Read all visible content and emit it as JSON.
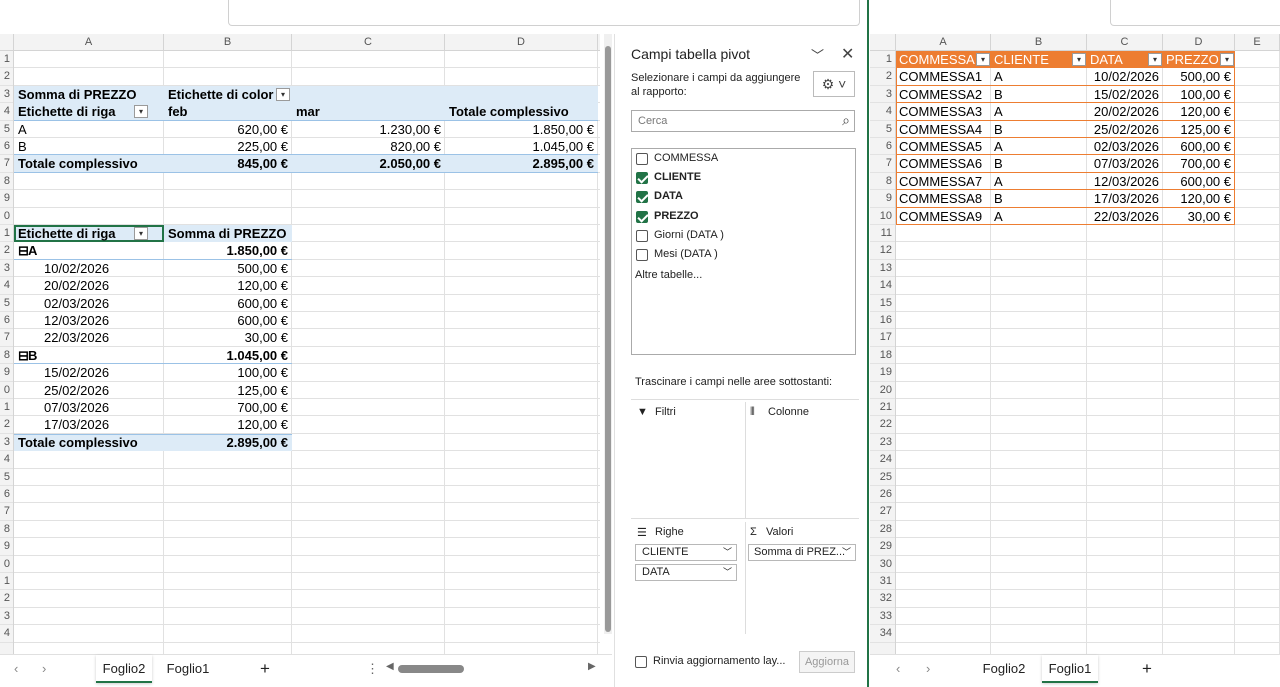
{
  "left": {
    "columns": [
      "A",
      "B",
      "C",
      "D"
    ],
    "rows": [
      "1",
      "2",
      "3",
      "4",
      "5",
      "6",
      "7",
      "8",
      "9",
      "0",
      "1",
      "2",
      "3",
      "4",
      "5",
      "6",
      "7",
      "8",
      "9",
      "0",
      "1",
      "2",
      "3",
      "4",
      "5",
      "6",
      "7",
      "8",
      "9",
      "0",
      "1",
      "2",
      "3",
      "4"
    ],
    "pivot1": {
      "sum_label": "Somma di PREZZO",
      "col_labels": "Etichette di color",
      "row_labels": "Etichette di riga",
      "feb": "feb",
      "mar": "mar",
      "total_hdr": "Totale complessivo",
      "rows": [
        {
          "k": "A",
          "feb": "620,00 €",
          "mar": "1.230,00 €",
          "tot": "1.850,00 €"
        },
        {
          "k": "B",
          "feb": "225,00 €",
          "mar": "820,00 €",
          "tot": "1.045,00 €"
        }
      ],
      "total_label": "Totale complessivo",
      "total_feb": "845,00 €",
      "total_mar": "2.050,00 €",
      "total_all": "2.895,00 €"
    },
    "pivot2": {
      "row_labels": "Etichette di riga",
      "sum_label": "Somma di PREZZO",
      "groups": [
        {
          "k": "A",
          "tot": "1.850,00 €",
          "items": [
            {
              "d": "10/02/2026",
              "v": "500,00 €"
            },
            {
              "d": "20/02/2026",
              "v": "120,00 €"
            },
            {
              "d": "02/03/2026",
              "v": "600,00 €"
            },
            {
              "d": "12/03/2026",
              "v": "600,00 €"
            },
            {
              "d": "22/03/2026",
              "v": "30,00 €"
            }
          ]
        },
        {
          "k": "B",
          "tot": "1.045,00 €",
          "items": [
            {
              "d": "15/02/2026",
              "v": "100,00 €"
            },
            {
              "d": "25/02/2026",
              "v": "125,00 €"
            },
            {
              "d": "07/03/2026",
              "v": "700,00 €"
            },
            {
              "d": "17/03/2026",
              "v": "120,00 €"
            }
          ]
        }
      ],
      "total_label": "Totale complessivo",
      "total": "2.895,00 €"
    },
    "tabs": [
      "Foglio2",
      "Foglio1"
    ],
    "active_tab": "Foglio2",
    "add": "+"
  },
  "pane": {
    "title": "Campi tabella pivot",
    "subtitle": "Selezionare i campi da aggiungere al rapporto:",
    "search_placeholder": "Cerca",
    "fields": [
      {
        "label": "COMMESSA",
        "checked": false
      },
      {
        "label": "CLIENTE",
        "checked": true
      },
      {
        "label": "DATA",
        "checked": true
      },
      {
        "label": "PREZZO",
        "checked": true
      },
      {
        "label": "Giorni (DATA )",
        "checked": false
      },
      {
        "label": "Mesi (DATA )",
        "checked": false
      }
    ],
    "more_tables": "Altre tabelle...",
    "drag_hint": "Trascinare i campi nelle aree sottostanti:",
    "filters": "Filtri",
    "columns": "Colonne",
    "rows": "Righe",
    "values": "Valori",
    "rows_items": [
      "CLIENTE",
      "DATA"
    ],
    "values_items": [
      "Somma di PREZ..."
    ],
    "defer": "Rinvia aggiornamento lay...",
    "update": "Aggiorna"
  },
  "right": {
    "columns": [
      "A",
      "B",
      "C",
      "D",
      "E"
    ],
    "rows": [
      "1",
      "2",
      "3",
      "4",
      "5",
      "6",
      "7",
      "8",
      "9",
      "10",
      "11",
      "12",
      "13",
      "14",
      "15",
      "16",
      "17",
      "18",
      "19",
      "20",
      "21",
      "22",
      "23",
      "24",
      "25",
      "26",
      "27",
      "28",
      "29",
      "30",
      "31",
      "32",
      "33",
      "34"
    ],
    "headers": [
      "COMMESSA",
      "CLIENTE",
      "DATA",
      "PREZZO"
    ],
    "data": [
      [
        "COMMESSA1",
        "A",
        "10/02/2026",
        "500,00 €"
      ],
      [
        "COMMESSA2",
        "B",
        "15/02/2026",
        "100,00 €"
      ],
      [
        "COMMESSA3",
        "A",
        "20/02/2026",
        "120,00 €"
      ],
      [
        "COMMESSA4",
        "B",
        "25/02/2026",
        "125,00 €"
      ],
      [
        "COMMESSA5",
        "A",
        "02/03/2026",
        "600,00 €"
      ],
      [
        "COMMESSA6",
        "B",
        "07/03/2026",
        "700,00 €"
      ],
      [
        "COMMESSA7",
        "A",
        "12/03/2026",
        "600,00 €"
      ],
      [
        "COMMESSA8",
        "B",
        "17/03/2026",
        "120,00 €"
      ],
      [
        "COMMESSA9",
        "A",
        "22/03/2026",
        "30,00 €"
      ]
    ],
    "tabs": [
      "Foglio2",
      "Foglio1"
    ],
    "active_tab": "Foglio1",
    "add": "+"
  },
  "colors": {
    "accent": "#217346",
    "orange": "#ed7d31",
    "pivot_blue": "#ddebf7"
  }
}
